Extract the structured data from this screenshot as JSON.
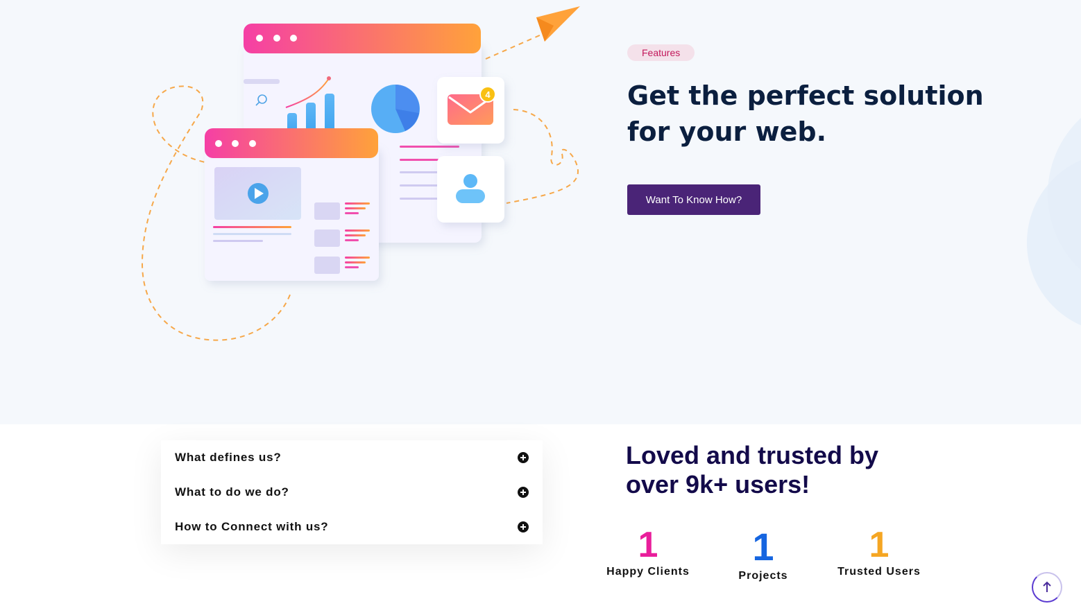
{
  "hero": {
    "badge": "Features",
    "title": "Get the perfect solution for your web.",
    "cta_label": "Want To Know How?",
    "mail_badge_count": "4"
  },
  "faq": {
    "items": [
      {
        "question": "What defines us?"
      },
      {
        "question": "What to do we do?"
      },
      {
        "question": "How to Connect with us?"
      }
    ]
  },
  "stats": {
    "title": "Loved and trusted by over 9k+ users!",
    "items": [
      {
        "value": "1",
        "label": "Happy Clients",
        "color": "#e91e9b"
      },
      {
        "value": "1",
        "label": "Projects",
        "color": "#1565e0"
      },
      {
        "value": "1",
        "label": "Trusted Users",
        "color": "#f5a623"
      }
    ]
  },
  "colors": {
    "accent_purple": "#4a2477",
    "title_navy": "#0b1f3f",
    "gradient_start": "#f53fa5",
    "gradient_end": "#ffa23a"
  },
  "icons": [
    "paper-plane-icon",
    "search-icon",
    "mail-icon",
    "user-icon",
    "play-icon",
    "plus-circle-icon",
    "arrow-up-icon"
  ]
}
